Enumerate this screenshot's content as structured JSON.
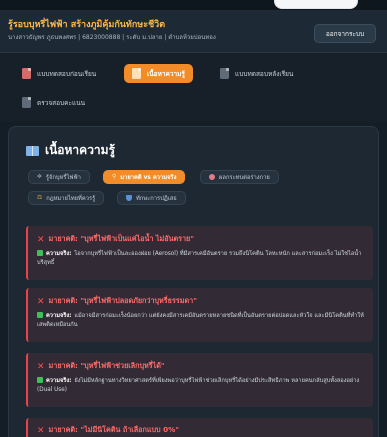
{
  "header": {
    "title": "รู้รอบบุหรี่ไฟฟ้า สร้างภูมิคุ้มกันทักษะชีวิต",
    "user_info": "นางสาวธัญพร ภูธนพงศพร | 6823000888 | ระดับ ม.ปลาย | ตำบลห้วยบ่อนทอง",
    "logout_label": "ออกจากระบบ"
  },
  "nav": {
    "items": [
      {
        "label": "แบบทดสอบก่อนเรียน",
        "icon": "document-icon"
      },
      {
        "label": "เนื้อหาความรู้",
        "icon": "document-icon",
        "active": true
      },
      {
        "label": "แบบทดสอบหลังเรียน",
        "icon": "document-icon"
      },
      {
        "label": "ตรวจสอบคะแนน",
        "icon": "document-icon"
      }
    ]
  },
  "content": {
    "section_title": "เนื้อหาความรู้",
    "section_icon": "book-icon",
    "subtabs": [
      {
        "label": "รู้จักบุหรี่ไฟฟ้า",
        "icon": "gear-icon"
      },
      {
        "label": "มายาคติ vs ความจริง",
        "icon": "search-icon",
        "active": true
      },
      {
        "label": "ผลกระทบต่อร่างกาย",
        "icon": "lungs-icon"
      },
      {
        "label": "กฎหมายไทยที่ควรรู้",
        "icon": "scales-icon"
      },
      {
        "label": "ทักษะการปฏิเสธ",
        "icon": "shield-icon"
      }
    ],
    "fact_label": "ความจริง:",
    "myths": [
      {
        "myth": "มายาคติ: \"บุหรี่ไฟฟ้าเป็นแค่ไอน้ำ ไม่อันตราย\"",
        "fact": "ไอจากบุหรี่ไฟฟ้าเป็นละอองฝอย (Aerosol) ที่มีสารเคมีอันตราย รวมถึงนิโคติน โลหะหนัก และสารก่อมะเร็ง ไม่ใช่ไอน้ำบริสุทธิ์"
      },
      {
        "myth": "มายาคติ: \"บุหรี่ไฟฟ้าปลอดภัยกว่าบุหรี่ธรรมดา\"",
        "fact": "แม้อาจมีสารก่อมะเร็งน้อยกว่า แต่ยังคงมีสารเคมีอันตรายหลายชนิดที่เป็นอันตรายต่อปอดและหัวใจ และมีนิโคตินที่ทำให้เสพติดเหมือนกัน"
      },
      {
        "myth": "มายาคติ: \"บุหรี่ไฟฟ้าช่วยเลิกบุหรี่ได้\"",
        "fact": "ยังไม่มีหลักฐานทางวิทยาศาสตร์ที่เพียงพอว่าบุหรี่ไฟฟ้าช่วยเลิกบุหรี่ได้อย่างมีประสิทธิภาพ หลายคนกลับสูบทั้งสองอย่าง (Dual Use)"
      },
      {
        "myth": "มายาคติ: \"ไม่มีนิโคติน ถ้าเลือกแบบ 0%\"",
        "fact": ""
      }
    ]
  },
  "colors": {
    "accent": "#f28c28",
    "title": "#ffb648",
    "myth": "#ff6b6b",
    "fact_check": "#3fbf5a",
    "background": "#141e27"
  }
}
